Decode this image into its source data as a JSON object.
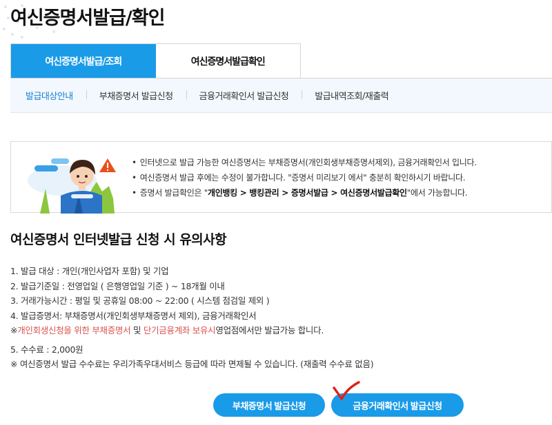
{
  "page": {
    "title": "여신증명서발급/확인"
  },
  "tabs": [
    {
      "label": "여신증명서발급/조회",
      "active": true
    },
    {
      "label": "여신증명서발급확인",
      "active": false
    }
  ],
  "subnav": [
    {
      "label": "발급대상안내",
      "active": true
    },
    {
      "label": "부채증명서 발급신청",
      "active": false
    },
    {
      "label": "금융거래확인서 발급신청",
      "active": false
    },
    {
      "label": "발급내역조회/재출력",
      "active": false
    }
  ],
  "notice": {
    "line1": "인터넷으로 발급 가능한 여신증명서는 부채증명서(개인회생부채증명서제외), 금융거래확인서 입니다.",
    "line2": "여신증명서 발급 후에는 수정이 불가합니다. \"증명서 미리보기 에서\" 충분히 확인하시기 바랍니다.",
    "line3_prefix": "증명서 발급확인은 \"",
    "line3_path": "개인뱅킹 > 뱅킹관리 > 증명서발급 > 여신증명서발급확인",
    "line3_suffix": "\"에서 가능합니다."
  },
  "section": {
    "title": "여신증명서 인터넷발급 신청 시 유의사항"
  },
  "terms": {
    "item1": "1. 발급 대상 : 개인(개인사업자 포함) 및 기업",
    "item2": "2. 발급기준일 : 전영업일 ( 은행영업일 기준 ) ~ 18개월 이내",
    "item3": "3. 거래가능시간 : 평일 및 공휴일 08:00 ~ 22:00 ( 시스템 점검일 제외 )",
    "item4": "4. 발급증명서: 부채증명서(개인회생부채증명서 제외), 금융거래확인서",
    "note4_prefix": "※",
    "note4_red1": "개인회생신청을 위한 부채증명서",
    "note4_mid": " 및 ",
    "note4_red2": "단기금융계좌 보유시",
    "note4_suffix": "영업점에서만 발급가능 합니다.",
    "item5": "5. 수수료 : 2,000원",
    "note5": "※ 여신증명서 발급 수수료는 우리가족우대서비스 등급에 따라 면제될 수 있습니다. (재출력 수수료 없음)"
  },
  "buttons": {
    "debt": "부채증명서 발급신청",
    "finance": "금융거래확인서 발급신청"
  },
  "colors": {
    "accent": "#1a9be8",
    "warning_text": "#d9534f",
    "annotation": "#e0201a"
  }
}
